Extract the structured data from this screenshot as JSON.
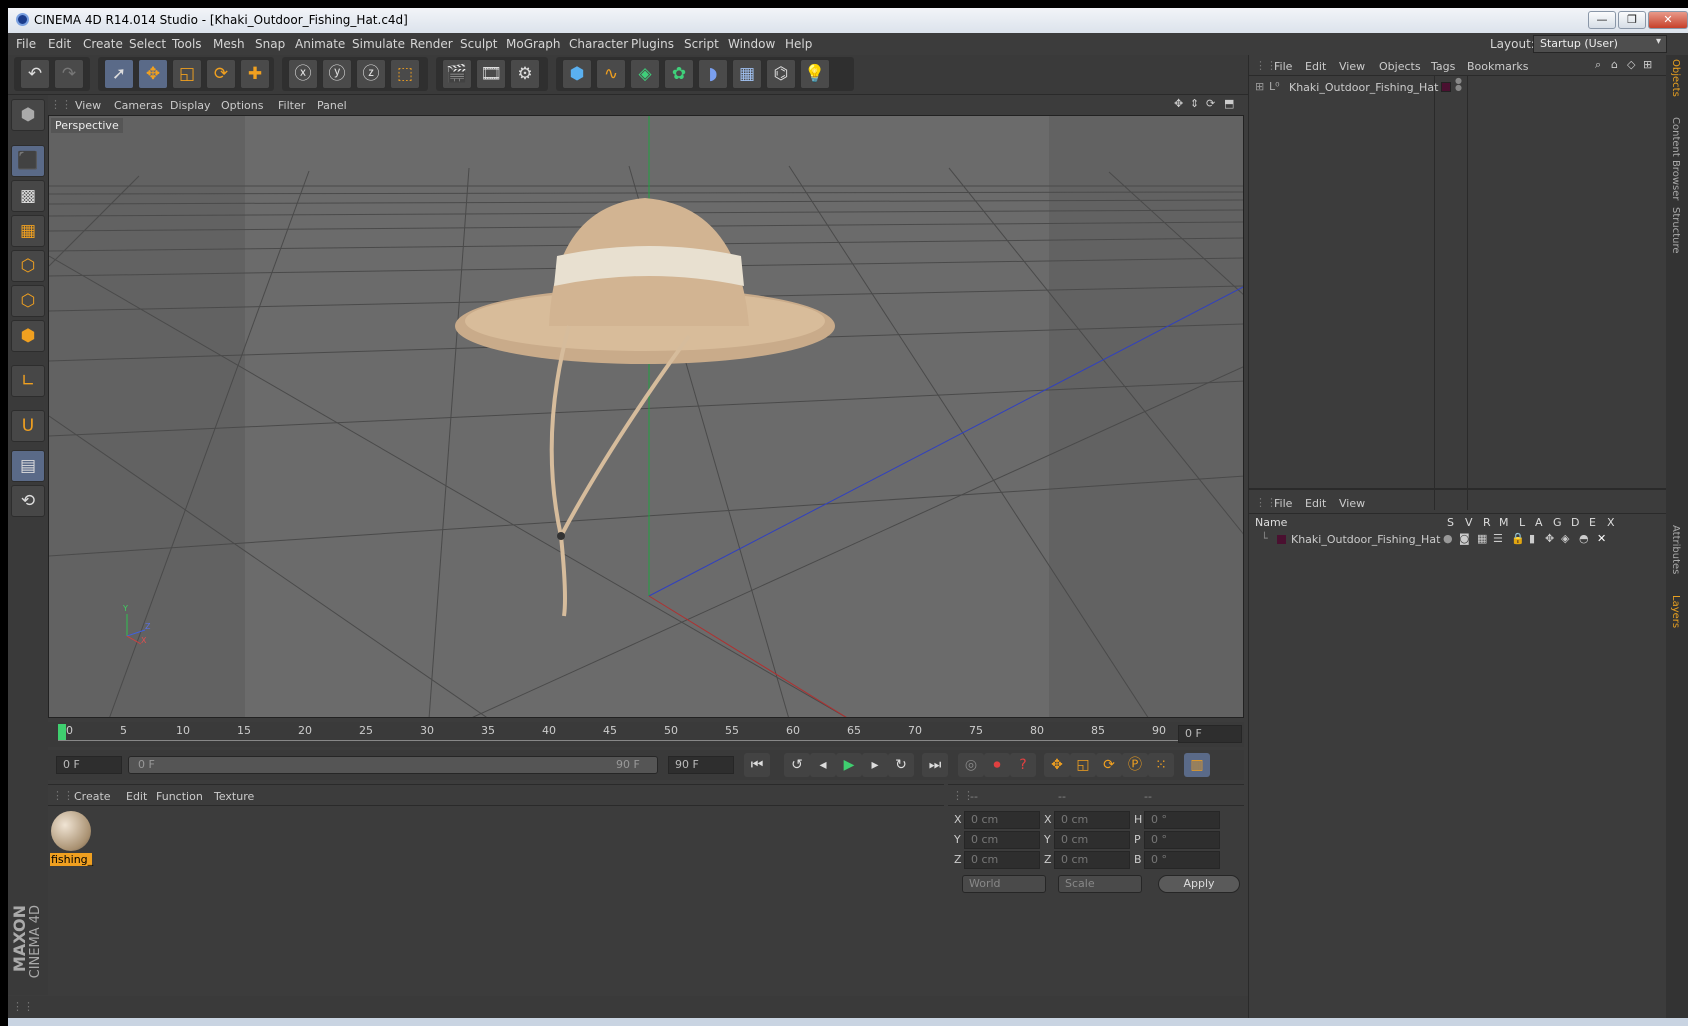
{
  "window": {
    "title": "CINEMA 4D R14.014 Studio - [Khaki_Outdoor_Fishing_Hat.c4d]",
    "minimize": "—",
    "maximize": "❐",
    "close": "✕"
  },
  "menu": [
    "File",
    "Edit",
    "Create",
    "Select",
    "Tools",
    "Mesh",
    "Snap",
    "Animate",
    "Simulate",
    "Render",
    "Sculpt",
    "MoGraph",
    "Character",
    "Plugins",
    "Script",
    "Window",
    "Help"
  ],
  "layout": {
    "label": "Layout:",
    "value": "Startup (User)"
  },
  "viewport": {
    "menu": [
      "View",
      "Cameras",
      "Display",
      "Options",
      "Filter",
      "Panel"
    ],
    "label": "Perspective",
    "axis_y": "Y",
    "axis_z": "Z",
    "axis_x": "X"
  },
  "timeline": {
    "ticks": [
      "0",
      "5",
      "10",
      "15",
      "20",
      "25",
      "30",
      "35",
      "40",
      "45",
      "50",
      "55",
      "60",
      "65",
      "70",
      "75",
      "80",
      "85",
      "90"
    ],
    "frame_field": "0 F"
  },
  "playback": {
    "current": "0 F",
    "range_start": "0 F",
    "range_end": "90 F",
    "max": "90 F"
  },
  "materials": {
    "menu": [
      "Create",
      "Edit",
      "Function",
      "Texture"
    ],
    "items": [
      {
        "name": "fishing_"
      }
    ]
  },
  "coords": {
    "headers": [
      "--",
      "--",
      "--"
    ],
    "rows": [
      {
        "a": "X",
        "av": "0 cm",
        "b": "X",
        "bv": "0 cm",
        "c": "H",
        "cv": "0 °"
      },
      {
        "a": "Y",
        "av": "0 cm",
        "b": "Y",
        "bv": "0 cm",
        "c": "P",
        "cv": "0 °"
      },
      {
        "a": "Z",
        "av": "0 cm",
        "b": "Z",
        "bv": "0 cm",
        "c": "B",
        "cv": "0 °"
      }
    ],
    "mode1": "World",
    "mode2": "Scale",
    "apply": "Apply"
  },
  "objects": {
    "menu": [
      "File",
      "Edit",
      "View",
      "Objects",
      "Tags",
      "Bookmarks"
    ],
    "items": [
      {
        "name": "Khaki_Outdoor_Fishing_Hat",
        "color": "#4a1030"
      }
    ]
  },
  "layers": {
    "menu": [
      "File",
      "Edit",
      "View"
    ],
    "columns": [
      "Name",
      "S",
      "V",
      "R",
      "M",
      "L",
      "A",
      "G",
      "D",
      "E",
      "X"
    ],
    "items": [
      {
        "name": "Khaki_Outdoor_Fishing_Hat"
      }
    ]
  },
  "sidetabs": {
    "top": [
      "Objects",
      "Content Browser",
      "Structure"
    ],
    "bottom": [
      "Attributes",
      "Layers"
    ]
  },
  "brand": {
    "maxon": "MAXON",
    "product": "CINEMA 4D"
  }
}
